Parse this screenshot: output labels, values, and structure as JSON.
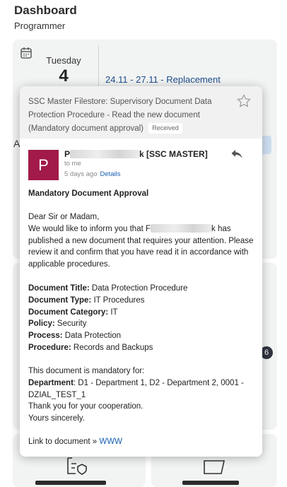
{
  "header": {
    "title": "Dashboard",
    "subtitle": "Programmer"
  },
  "date_card": {
    "day_name": "Tuesday",
    "day_number": "4",
    "event": "24.11 - 27.11 - Replacement"
  },
  "background": {
    "partial_letter": "A",
    "badge": "6"
  },
  "email": {
    "subject": "SSC Master Filestore: Supervisory Document Data Protection Procedure - Read the new document (Mandatory document approval)",
    "received_label": "Received",
    "avatar_letter": "P",
    "sender_prefix": "P",
    "sender_suffix": "k [SSC MASTER]",
    "to": "to me",
    "age": "5 days ago",
    "details_link": "Details",
    "heading": "Mandatory Document Approval",
    "greeting": "Dear Sir or Madam,",
    "intro_before": "We would like to inform you that F",
    "intro_after": "k has published a new document that requires your attention. Please review it and confirm that you have read it in accordance with applicable procedures.",
    "fields": [
      {
        "label": "Document Title:",
        "value": "Data Protection Procedure"
      },
      {
        "label": "Document Type:",
        "value": "IT Procedures"
      },
      {
        "label": "Document Category:",
        "value": "IT"
      },
      {
        "label": "Policy:",
        "value": "Security"
      },
      {
        "label": "Process:",
        "value": "Data Protection"
      },
      {
        "label": "Procedure:",
        "value": "Records and Backups"
      }
    ],
    "mandatory_intro": "This document is mandatory for:",
    "department_label": "Department",
    "department_value": ": D1 - Department 1, D2 - Department 2, 0001 - DZIAL_TEST_1",
    "thanks": "Thank you for your cooperation.",
    "closing": "Yours sincerely.",
    "link_prefix": "Link to document »",
    "link_text": "WWW"
  },
  "colors": {
    "accent": "#1a5fb4",
    "avatar": "#a11a4a",
    "card_bg": "#f2f4f3"
  },
  "icons": [
    "calendar-icon",
    "star-icon",
    "reply-icon",
    "document-icon",
    "folder-icon"
  ]
}
